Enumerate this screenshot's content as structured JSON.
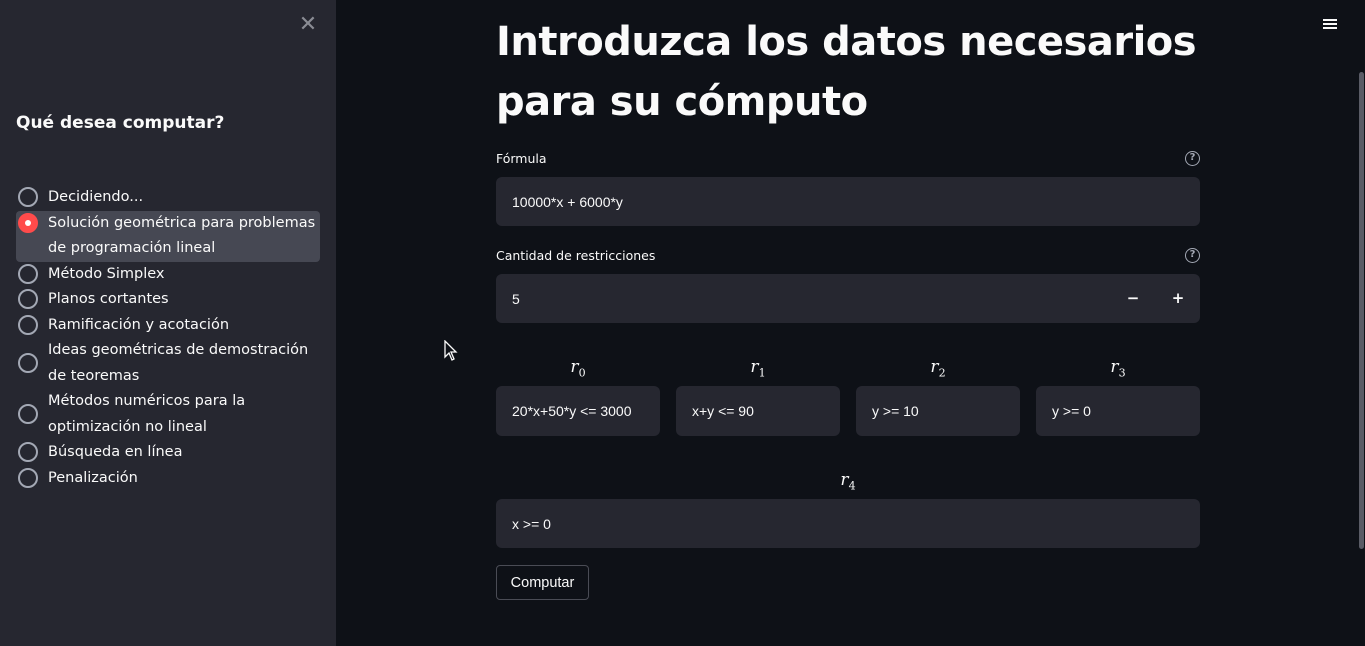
{
  "sidebar": {
    "title": "Qué desea computar?",
    "close_icon": "close-icon",
    "options": [
      {
        "label": "Decidiendo...",
        "selected": false
      },
      {
        "label": "Solución geométrica para problemas de programación lineal",
        "selected": true
      },
      {
        "label": "Método Simplex",
        "selected": false
      },
      {
        "label": "Planos cortantes",
        "selected": false
      },
      {
        "label": "Ramificación y acotación",
        "selected": false
      },
      {
        "label": "Ideas geométricas de demostración de teoremas",
        "selected": false
      },
      {
        "label": "Métodos numéricos para la optimización no lineal",
        "selected": false
      },
      {
        "label": "Búsqueda en línea",
        "selected": false
      },
      {
        "label": "Penalización",
        "selected": false
      }
    ]
  },
  "main": {
    "title": "Introduzca los datos necesarios para su cómputo",
    "formula": {
      "label": "Fórmula",
      "value": "10000*x + 6000*y"
    },
    "restrictions_count": {
      "label": "Cantidad de restricciones",
      "value": "5",
      "minus": "−",
      "plus": "+"
    },
    "restrictions": [
      {
        "var": "r",
        "sub": "0",
        "value": "20*x+50*y <= 3000"
      },
      {
        "var": "r",
        "sub": "1",
        "value": "x+y <= 90"
      },
      {
        "var": "r",
        "sub": "2",
        "value": "y >= 10"
      },
      {
        "var": "r",
        "sub": "3",
        "value": "y >= 0"
      },
      {
        "var": "r",
        "sub": "4",
        "value": "x >= 0"
      }
    ],
    "compute_button": "Computar",
    "help_glyph": "?"
  },
  "colors": {
    "accent": "#ff4b4b",
    "background": "#0e1117",
    "sidebar": "#262730",
    "input": "#262730"
  }
}
